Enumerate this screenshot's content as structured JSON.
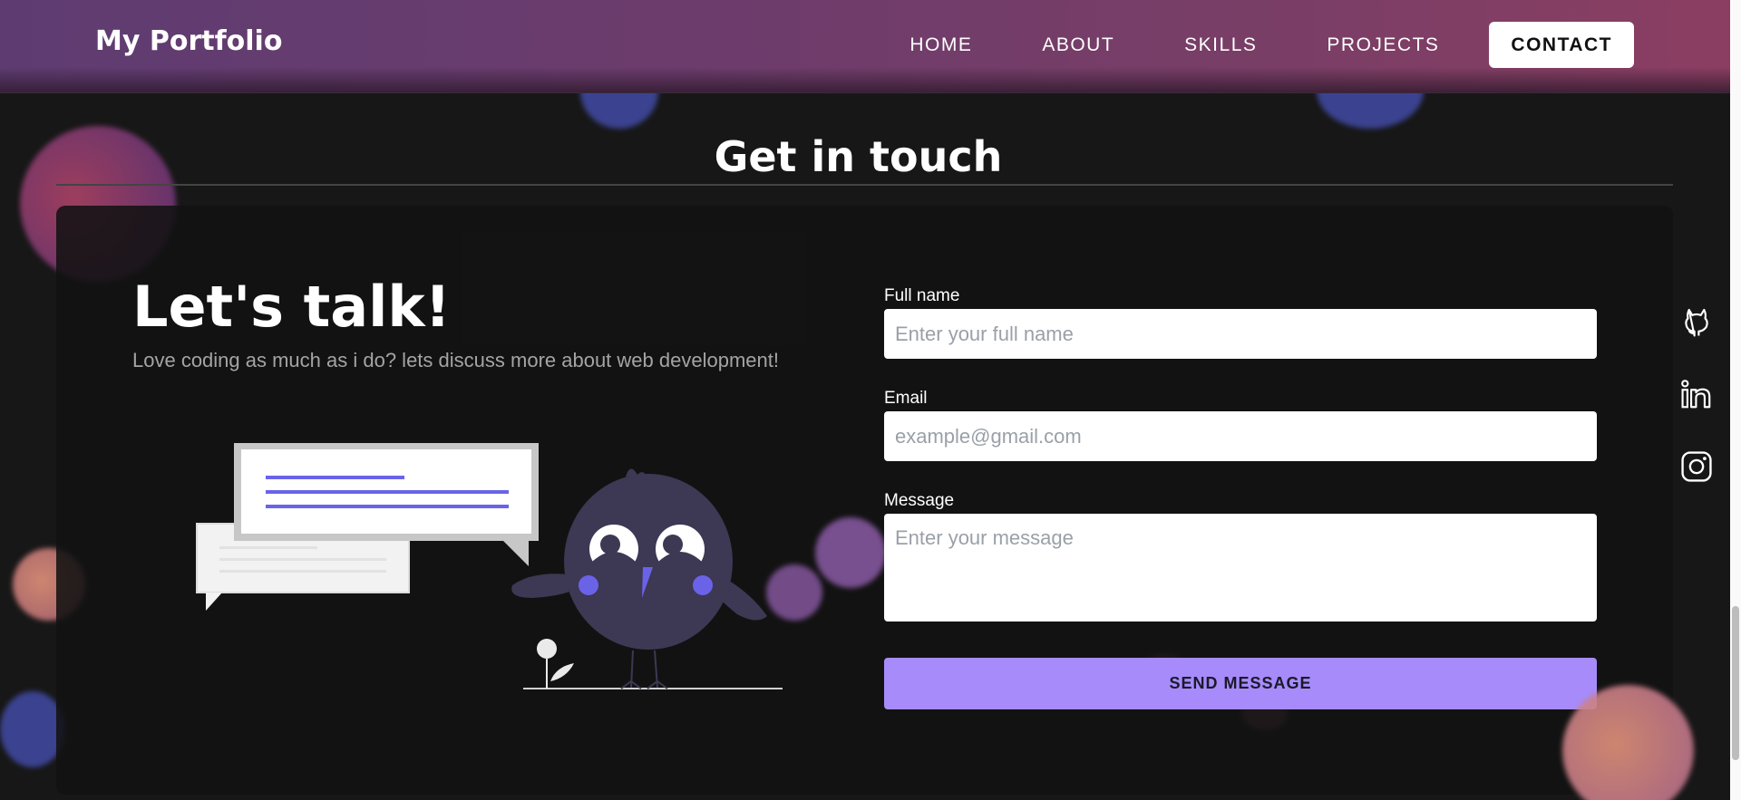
{
  "nav": {
    "brand": "My Portfolio",
    "links": [
      "HOME",
      "ABOUT",
      "SKILLS",
      "PROJECTS"
    ],
    "contact": "CONTACT"
  },
  "section": {
    "title": "Get in touch"
  },
  "intro": {
    "heading": "Let's talk!",
    "subtitle": "Love coding as much as i do? lets discuss more about web development!"
  },
  "form": {
    "fullname_label": "Full name",
    "fullname_placeholder": "Enter your full name",
    "email_label": "Email",
    "email_placeholder": "example@gmail.com",
    "message_label": "Message",
    "message_placeholder": "Enter your message",
    "submit_label": "SEND MESSAGE"
  },
  "socials": [
    "github-icon",
    "linkedin-icon",
    "instagram-icon"
  ],
  "colors": {
    "accent": "#a78bfa",
    "background": "#171717",
    "nav_gradient_start": "#5e3c72",
    "nav_gradient_end": "#8b3e62"
  }
}
